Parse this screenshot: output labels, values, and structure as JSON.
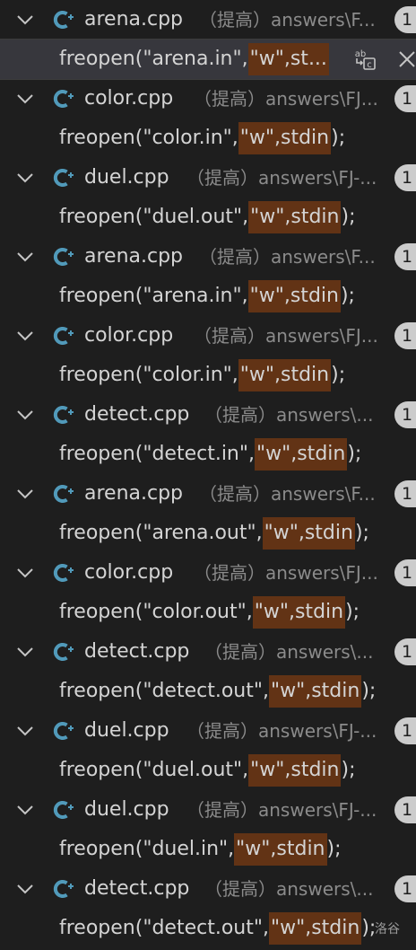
{
  "search_results": [
    {
      "file": "arena.cpp",
      "group": "（提高）",
      "path": "answers\\F...",
      "count": "1",
      "match": {
        "before": "freopen(\"arena.in\",",
        "highlight": "\"w\",st...",
        "after": ""
      },
      "selected": true
    },
    {
      "file": "color.cpp",
      "group": "（提高）",
      "path": "answers\\FJ...",
      "count": "1",
      "match": {
        "before": "freopen(\"color.in\",",
        "highlight": "\"w\",stdin",
        "after": ");"
      }
    },
    {
      "file": "duel.cpp",
      "group": "（提高）",
      "path": "answers\\FJ-...",
      "count": "1",
      "match": {
        "before": "freopen(\"duel.out\",",
        "highlight": "\"w\",stdin",
        "after": ");"
      }
    },
    {
      "file": "arena.cpp",
      "group": "（提高）",
      "path": "answers\\F...",
      "count": "1",
      "match": {
        "before": "freopen(\"arena.in\",",
        "highlight": "\"w\",stdin",
        "after": ");"
      }
    },
    {
      "file": "color.cpp",
      "group": "（提高）",
      "path": "answers\\FJ...",
      "count": "1",
      "match": {
        "before": "freopen(\"color.in\",",
        "highlight": "\"w\",stdin",
        "after": ");"
      }
    },
    {
      "file": "detect.cpp",
      "group": "（提高）",
      "path": "answers\\...",
      "count": "1",
      "match": {
        "before": "freopen(\"detect.in\",",
        "highlight": "\"w\",stdin",
        "after": ");"
      }
    },
    {
      "file": "arena.cpp",
      "group": "（提高）",
      "path": "answers\\F...",
      "count": "1",
      "match": {
        "before": "freopen(\"arena.out\",",
        "highlight": "\"w\",stdin",
        "after": ");"
      }
    },
    {
      "file": "color.cpp",
      "group": "（提高）",
      "path": "answers\\FJ...",
      "count": "1",
      "match": {
        "before": "freopen(\"color.out\",",
        "highlight": "\"w\",stdin",
        "after": ");"
      }
    },
    {
      "file": "detect.cpp",
      "group": "（提高）",
      "path": "answers\\...",
      "count": "1",
      "match": {
        "before": "freopen(\"detect.out\",",
        "highlight": "\"w\",stdin",
        "after": ");"
      }
    },
    {
      "file": "duel.cpp",
      "group": "（提高）",
      "path": "answers\\FJ-...",
      "count": "1",
      "match": {
        "before": "freopen(\"duel.out\",",
        "highlight": "\"w\",stdin",
        "after": ");"
      }
    },
    {
      "file": "duel.cpp",
      "group": "（提高）",
      "path": "answers\\FJ-...",
      "count": "1",
      "match": {
        "before": "freopen(\"duel.in\",",
        "highlight": "\"w\",stdin",
        "after": ");"
      }
    },
    {
      "file": "detect.cpp",
      "group": "（提高）",
      "path": "answers\\...",
      "count": "1",
      "match": {
        "before": "freopen(\"detect.out\",",
        "highlight": "\"w\",stdin",
        "after": ");"
      }
    }
  ],
  "watermark": "洛谷",
  "icons": {
    "twistie": "chevron-down-icon",
    "file_type": "cpp-file-icon",
    "replace_action": "replace-icon",
    "dismiss_action": "close-icon"
  },
  "colors": {
    "background": "#1e1e1e",
    "match_highlight": "#623315",
    "cpp_icon": "#519aba",
    "selected_row": "#37373d"
  }
}
